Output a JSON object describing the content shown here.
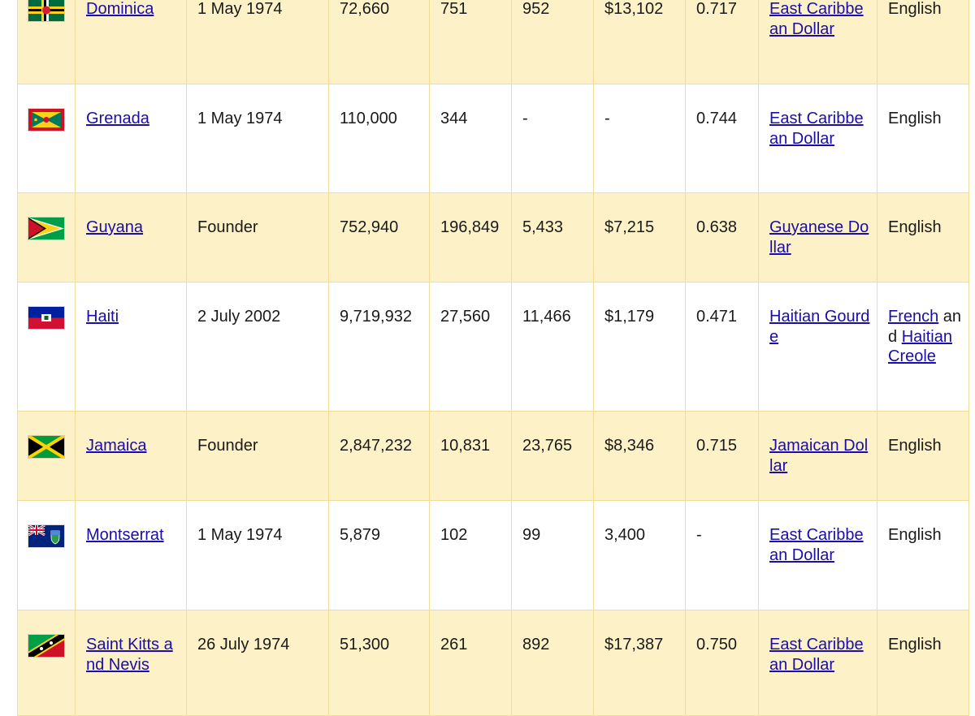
{
  "rows": [
    {
      "flag": "dominica-flag",
      "country": "Dominica",
      "joined": "1 May 1974",
      "population": "72,660",
      "area": "751",
      "gdp": "952",
      "gdp_per_capita": "$13,102",
      "hdi": "0.717",
      "currency": "East Caribbean Dollar",
      "language_parts": [
        {
          "text": "English",
          "link": false
        }
      ],
      "style": "alt",
      "height": 135
    },
    {
      "flag": "grenada-flag",
      "country": "Grenada",
      "joined": "1 May 1974",
      "population": "110,000",
      "area": "344",
      "gdp": "-",
      "gdp_per_capita": "-",
      "hdi": "0.744",
      "currency": "East Caribbean Dollar",
      "language_parts": [
        {
          "text": "English",
          "link": false
        }
      ],
      "style": "plain",
      "height": 134
    },
    {
      "flag": "guyana-flag",
      "country": "Guyana",
      "joined": "Founder",
      "population": "752,940",
      "area": "196,849",
      "gdp": "5,433",
      "gdp_per_capita": "$7,215",
      "hdi": "0.638",
      "currency": "Guyanese Dollar",
      "language_parts": [
        {
          "text": "English",
          "link": false
        }
      ],
      "style": "alt",
      "height": 110
    },
    {
      "flag": "haiti-flag",
      "country": "Haiti",
      "joined": "2 July 2002",
      "population": "9,719,932",
      "area": "27,560",
      "gdp": "11,466",
      "gdp_per_capita": "$1,179",
      "hdi": "0.471",
      "currency": "Haitian Gourde",
      "language_parts": [
        {
          "text": "French",
          "link": true
        },
        {
          "text": " and ",
          "link": false
        },
        {
          "text": "Haitian Creole",
          "link": true
        }
      ],
      "style": "plain",
      "height": 159
    },
    {
      "flag": "jamaica-flag",
      "country": "Jamaica",
      "joined": "Founder",
      "population": "2,847,232",
      "area": "10,831",
      "gdp": "23,765",
      "gdp_per_capita": "$8,346",
      "hdi": "0.715",
      "currency": "Jamaican Dollar",
      "language_parts": [
        {
          "text": "English",
          "link": false
        }
      ],
      "style": "alt",
      "height": 110
    },
    {
      "flag": "montserrat-flag",
      "country": "Montserrat",
      "joined": "1 May 1974",
      "population": "5,879",
      "area": "102",
      "gdp": "99",
      "gdp_per_capita": "3,400",
      "hdi": "-",
      "currency": "East Caribbean Dollar",
      "language_parts": [
        {
          "text": "English",
          "link": false
        }
      ],
      "style": "plain",
      "height": 135
    },
    {
      "flag": "saint-kitts-and-nevis-flag",
      "country": "Saint Kitts and Nevis",
      "joined": "26 July 1974",
      "population": "51,300",
      "area": "261",
      "gdp": "892",
      "gdp_per_capita": "$17,387",
      "hdi": "0.750",
      "currency": "East Caribbean Dollar",
      "language_parts": [
        {
          "text": "English",
          "link": false
        }
      ],
      "style": "alt",
      "height": 130
    }
  ]
}
